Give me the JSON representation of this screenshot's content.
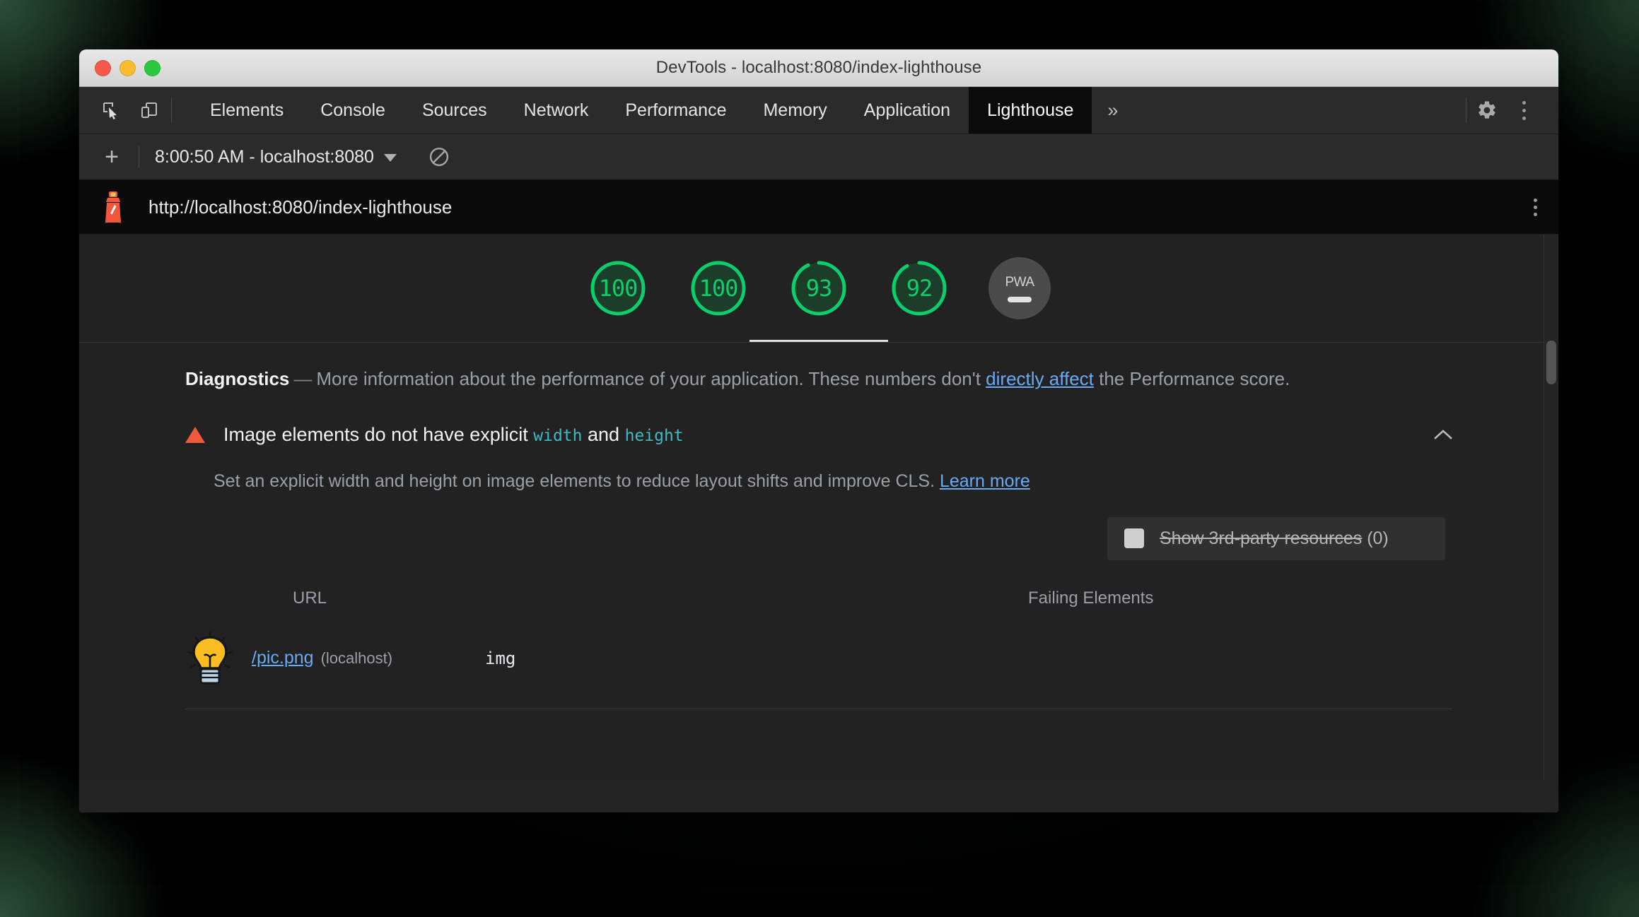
{
  "window": {
    "title": "DevTools - localhost:8080/index-lighthouse",
    "traffic_lights": [
      "close",
      "minimize",
      "zoom"
    ]
  },
  "tabstrip": {
    "icons": [
      {
        "name": "inspect-element-icon"
      },
      {
        "name": "device-toolbar-icon"
      }
    ],
    "tabs": [
      {
        "label": "Elements",
        "active": false
      },
      {
        "label": "Console",
        "active": false
      },
      {
        "label": "Sources",
        "active": false
      },
      {
        "label": "Network",
        "active": false
      },
      {
        "label": "Performance",
        "active": false
      },
      {
        "label": "Memory",
        "active": false
      },
      {
        "label": "Application",
        "active": false
      },
      {
        "label": "Lighthouse",
        "active": true
      }
    ],
    "more_tabs_label": "»",
    "settings_icon": "gear-icon",
    "more_options_icon": "three-dots-vertical-icon"
  },
  "runbar": {
    "new_report_label": "+",
    "selected_run": "8:00:50 AM - localhost:8080",
    "clear_icon": "no-entry-icon"
  },
  "report_header": {
    "logo": "lighthouse-logo",
    "url": "http://localhost:8080/index-lighthouse",
    "menu_icon": "three-dots-vertical-icon"
  },
  "scores": {
    "gauges": [
      {
        "value": "100",
        "percent": 100,
        "selected": false
      },
      {
        "value": "100",
        "percent": 100,
        "selected": false
      },
      {
        "value": "93",
        "percent": 93,
        "selected": true
      },
      {
        "value": "92",
        "percent": 92,
        "selected": false
      }
    ],
    "pwa": {
      "label": "PWA",
      "state": "dash"
    },
    "pass_color": "#0cce6b",
    "track_color": "#1d3d2b"
  },
  "diagnostics": {
    "heading": "Diagnostics",
    "dash": "—",
    "text_before_link": "More information about the performance of your application. These numbers don't ",
    "link_text": "directly affect",
    "text_after_link": " the Performance score."
  },
  "audit": {
    "icon": "warning-triangle-icon",
    "title_part1": "Image elements do not have explicit ",
    "title_code1": "width",
    "title_part2": " and ",
    "title_code2": "height",
    "collapse_icon": "chevron-up-icon",
    "description_before_link": "Set an explicit width and height on image elements to reduce layout shifts and improve CLS. ",
    "description_link": "Learn more",
    "filter": {
      "checkbox_state": "unchecked",
      "label_struck": "Show 3rd-party resources",
      "count": "(0)"
    },
    "table": {
      "columns": [
        "URL",
        "Failing Elements"
      ],
      "rows": [
        {
          "thumbnail": "lightbulb-image-thumbnail",
          "url": "/pic.png",
          "host": "(localhost)",
          "failing_element": "img"
        }
      ]
    }
  }
}
